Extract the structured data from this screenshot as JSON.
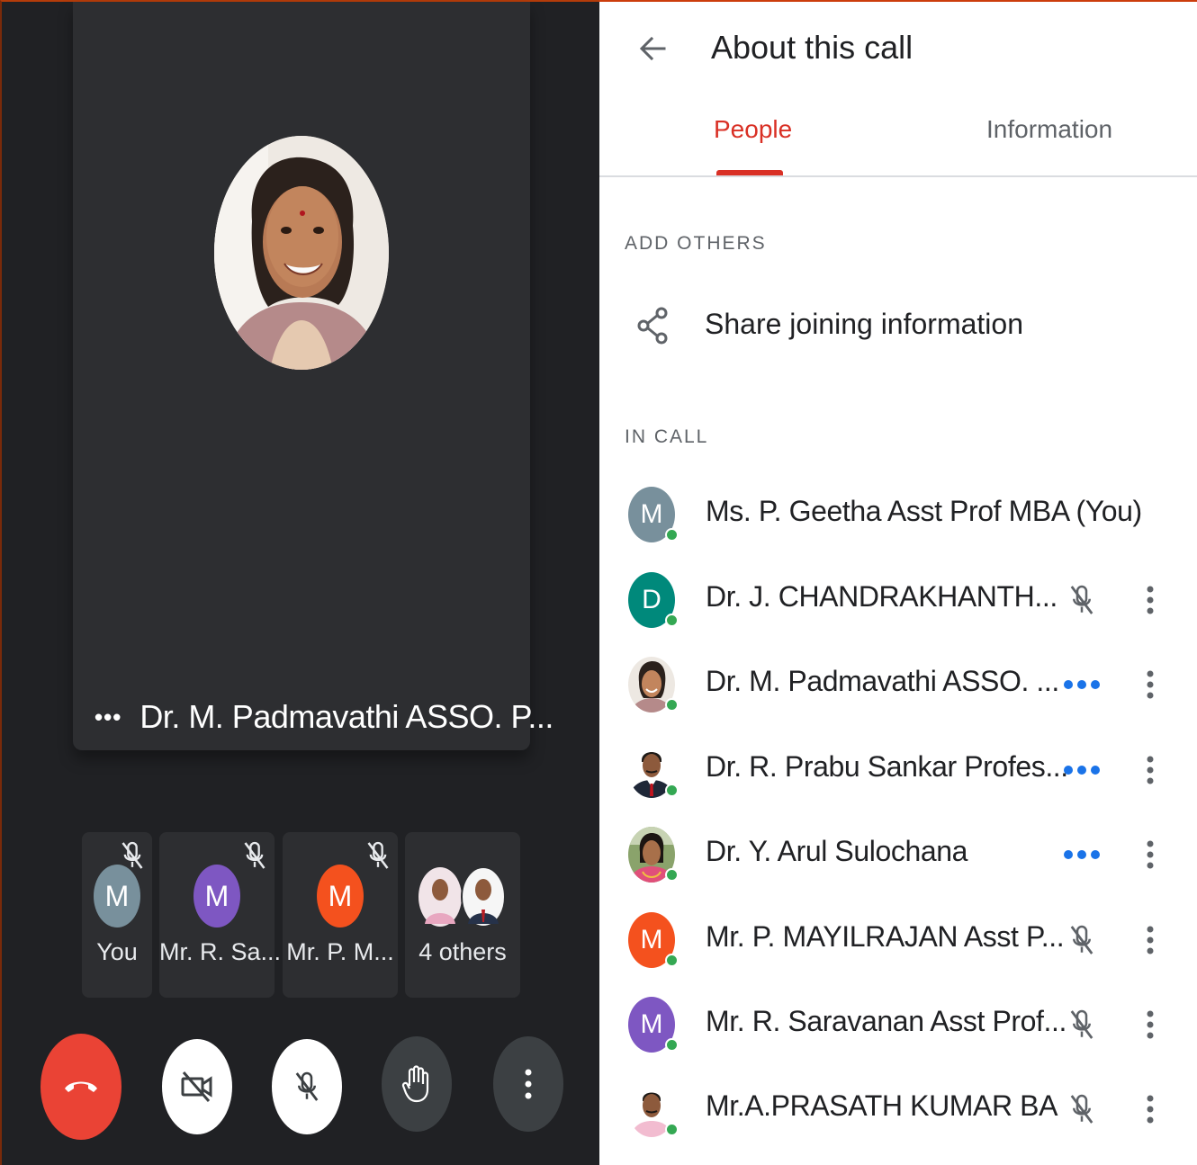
{
  "call": {
    "main_speaker_name": "Dr. M. Padmavathi ASSO. P...",
    "thumbnails": [
      {
        "letter": "M",
        "label": "You",
        "color": "#78909c",
        "muted": true
      },
      {
        "letter": "M",
        "label": "Mr. R. Sa...",
        "color": "#7e57c2",
        "muted": true
      },
      {
        "letter": "M",
        "label": "Mr. P. M...",
        "color": "#f4511e",
        "muted": true
      },
      {
        "letter": "",
        "label": "4 others",
        "color": "",
        "muted": false
      }
    ],
    "controls": [
      "end-call",
      "camera-off",
      "mic-off",
      "raise-hand",
      "more-options"
    ],
    "end_call_color": "#ea4335"
  },
  "about": {
    "title": "About this call",
    "tabs": [
      {
        "label": "People",
        "active": true
      },
      {
        "label": "Information",
        "active": false
      }
    ],
    "active_color": "#d93025",
    "add_others_label": "ADD OTHERS",
    "share_label": "Share joining information",
    "in_call_label": "IN CALL",
    "people": [
      {
        "name": "Ms. P. Geetha Asst Prof MBA (You)",
        "letter": "M",
        "color": "#78909c",
        "status": "none"
      },
      {
        "name": "Dr. J. CHANDRAKHANTH...",
        "letter": "D",
        "color": "#00897b",
        "status": "muted"
      },
      {
        "name": "Dr. M. Padmavathi ASSO. ...",
        "letter": "",
        "color": "",
        "status": "speaking"
      },
      {
        "name": "Dr. R. Prabu Sankar Profes...",
        "letter": "",
        "color": "",
        "status": "speaking"
      },
      {
        "name": "Dr. Y. Arul Sulochana",
        "letter": "",
        "color": "",
        "status": "speaking"
      },
      {
        "name": "Mr. P. MAYILRAJAN Asst P...",
        "letter": "M",
        "color": "#f4511e",
        "status": "muted"
      },
      {
        "name": "Mr. R. Saravanan Asst Prof...",
        "letter": "M",
        "color": "#7e57c2",
        "status": "muted"
      },
      {
        "name": "Mr.A.PRASATH KUMAR BA",
        "letter": "",
        "color": "",
        "status": "muted"
      }
    ]
  }
}
